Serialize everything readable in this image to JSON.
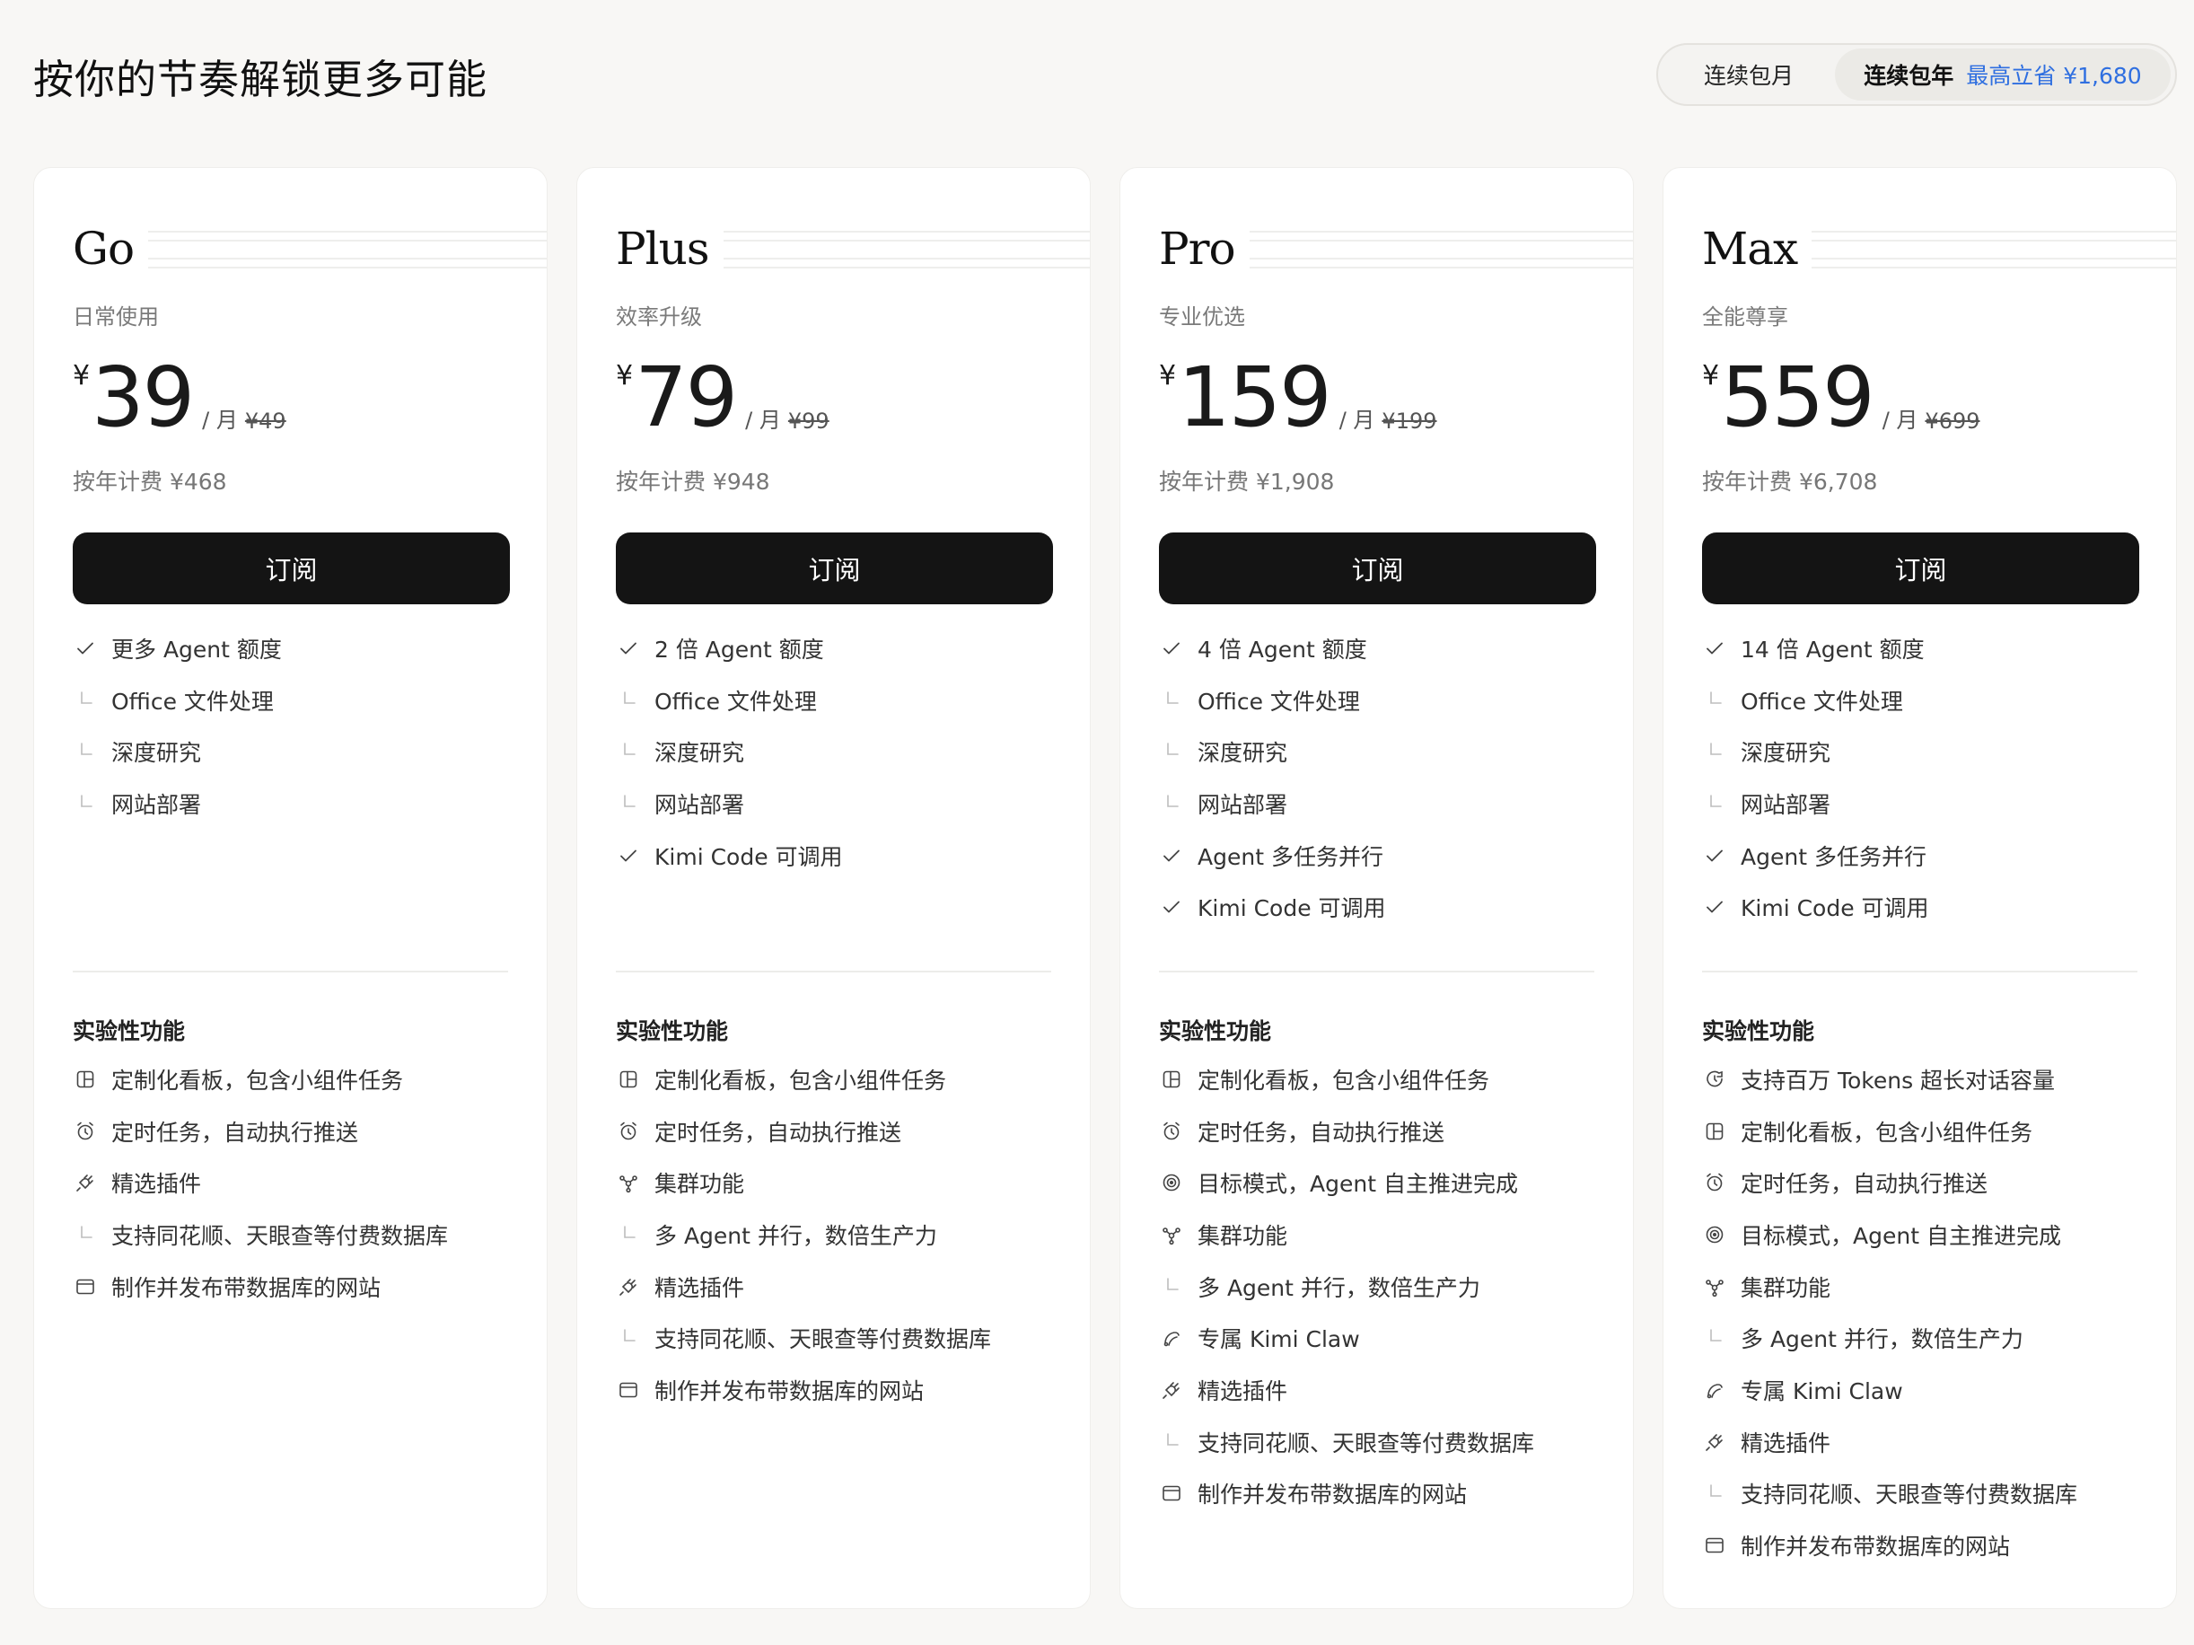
{
  "header": {
    "title": "按你的节奏解锁更多可能",
    "toggle": {
      "monthly_label": "连续包月",
      "yearly_label": "连续包年",
      "yearly_save": "最高立省 ¥1,680"
    }
  },
  "currency_symbol": "¥",
  "per_month": "/ 月",
  "subscribe_label": "订阅",
  "experimental_title": "实验性功能",
  "plans": [
    {
      "name": "Go",
      "tagline": "日常使用",
      "price": "39",
      "old_price": "¥49",
      "yearly": "按年计费 ¥468",
      "features": [
        {
          "icon": "check-icon",
          "text": "更多 Agent 额度"
        },
        {
          "icon": "sub-item-icon",
          "text": "Office 文件处理"
        },
        {
          "icon": "sub-item-icon",
          "text": "深度研究"
        },
        {
          "icon": "sub-item-icon",
          "text": "网站部署"
        }
      ],
      "experimental": [
        {
          "icon": "dashboard-icon",
          "text": "定制化看板，包含小组件任务"
        },
        {
          "icon": "alarm-icon",
          "text": "定时任务，自动执行推送"
        },
        {
          "icon": "plugin-icon",
          "text": "精选插件"
        },
        {
          "icon": "sub-item-icon",
          "text": "支持同花顺、天眼查等付费数据库"
        },
        {
          "icon": "browser-window-icon",
          "text": "制作并发布带数据库的网站"
        }
      ]
    },
    {
      "name": "Plus",
      "tagline": "效率升级",
      "price": "79",
      "old_price": "¥99",
      "yearly": "按年计费 ¥948",
      "features": [
        {
          "icon": "check-icon",
          "text": "2 倍 Agent 额度"
        },
        {
          "icon": "sub-item-icon",
          "text": "Office 文件处理"
        },
        {
          "icon": "sub-item-icon",
          "text": "深度研究"
        },
        {
          "icon": "sub-item-icon",
          "text": "网站部署"
        },
        {
          "icon": "check-icon",
          "text": "Kimi Code 可调用"
        }
      ],
      "experimental": [
        {
          "icon": "dashboard-icon",
          "text": "定制化看板，包含小组件任务"
        },
        {
          "icon": "alarm-icon",
          "text": "定时任务，自动执行推送"
        },
        {
          "icon": "cluster-icon",
          "text": "集群功能"
        },
        {
          "icon": "sub-item-icon",
          "text": "多 Agent 并行，数倍生产力"
        },
        {
          "icon": "plugin-icon",
          "text": "精选插件"
        },
        {
          "icon": "sub-item-icon",
          "text": "支持同花顺、天眼查等付费数据库"
        },
        {
          "icon": "browser-window-icon",
          "text": "制作并发布带数据库的网站"
        }
      ]
    },
    {
      "name": "Pro",
      "tagline": "专业优选",
      "price": "159",
      "old_price": "¥199",
      "yearly": "按年计费 ¥1,908",
      "features": [
        {
          "icon": "check-icon",
          "text": "4 倍 Agent 额度"
        },
        {
          "icon": "sub-item-icon",
          "text": "Office 文件处理"
        },
        {
          "icon": "sub-item-icon",
          "text": "深度研究"
        },
        {
          "icon": "sub-item-icon",
          "text": "网站部署"
        },
        {
          "icon": "check-icon",
          "text": "Agent 多任务并行"
        },
        {
          "icon": "check-icon",
          "text": "Kimi Code 可调用"
        }
      ],
      "experimental": [
        {
          "icon": "dashboard-icon",
          "text": "定制化看板，包含小组件任务"
        },
        {
          "icon": "alarm-icon",
          "text": "定时任务，自动执行推送"
        },
        {
          "icon": "target-icon",
          "text": "目标模式，Agent 自主推进完成"
        },
        {
          "icon": "cluster-icon",
          "text": "集群功能"
        },
        {
          "icon": "sub-item-icon",
          "text": "多 Agent 并行，数倍生产力"
        },
        {
          "icon": "claw-icon",
          "text": "专属 Kimi Claw"
        },
        {
          "icon": "plugin-icon",
          "text": "精选插件"
        },
        {
          "icon": "sub-item-icon",
          "text": "支持同花顺、天眼查等付费数据库"
        },
        {
          "icon": "browser-window-icon",
          "text": "制作并发布带数据库的网站"
        }
      ]
    },
    {
      "name": "Max",
      "tagline": "全能尊享",
      "price": "559",
      "old_price": "¥699",
      "yearly": "按年计费 ¥6,708",
      "features": [
        {
          "icon": "check-icon",
          "text": "14 倍 Agent 额度"
        },
        {
          "icon": "sub-item-icon",
          "text": "Office 文件处理"
        },
        {
          "icon": "sub-item-icon",
          "text": "深度研究"
        },
        {
          "icon": "sub-item-icon",
          "text": "网站部署"
        },
        {
          "icon": "check-icon",
          "text": "Agent 多任务并行"
        },
        {
          "icon": "check-icon",
          "text": "Kimi Code 可调用"
        }
      ],
      "experimental": [
        {
          "icon": "chat-capacity-icon",
          "text": "支持百万 Tokens 超长对话容量"
        },
        {
          "icon": "dashboard-icon",
          "text": "定制化看板，包含小组件任务"
        },
        {
          "icon": "alarm-icon",
          "text": "定时任务，自动执行推送"
        },
        {
          "icon": "target-icon",
          "text": "目标模式，Agent 自主推进完成"
        },
        {
          "icon": "cluster-icon",
          "text": "集群功能"
        },
        {
          "icon": "sub-item-icon",
          "text": "多 Agent 并行，数倍生产力"
        },
        {
          "icon": "claw-icon",
          "text": "专属 Kimi Claw"
        },
        {
          "icon": "plugin-icon",
          "text": "精选插件"
        },
        {
          "icon": "sub-item-icon",
          "text": "支持同花顺、天眼查等付费数据库"
        },
        {
          "icon": "browser-window-icon",
          "text": "制作并发布带数据库的网站"
        }
      ]
    }
  ],
  "colors": {
    "background": "#f8f7f5",
    "card": "#ffffff",
    "button": "#141414",
    "accent_blue": "#2f6fe0"
  }
}
